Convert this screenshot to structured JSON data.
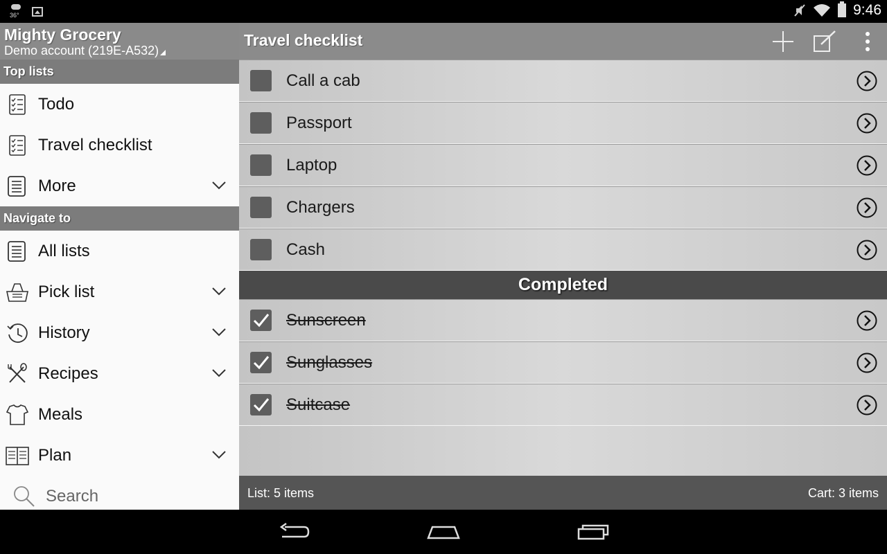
{
  "status_bar": {
    "weather_temp": "36°",
    "time": "9:46"
  },
  "drawer": {
    "app_title": "Mighty Grocery",
    "account": "Demo account (219E-A532)",
    "top_lists_header": "Top lists",
    "top_lists": [
      {
        "label": "Todo",
        "icon": "checklist-icon"
      },
      {
        "label": "Travel checklist",
        "icon": "checklist-icon"
      },
      {
        "label": "More",
        "icon": "list-icon"
      }
    ],
    "navigate_header": "Navigate to",
    "navigate": [
      {
        "label": "All lists",
        "icon": "list-icon"
      },
      {
        "label": "Pick list",
        "icon": "basket-icon"
      },
      {
        "label": "History",
        "icon": "history-icon"
      },
      {
        "label": "Recipes",
        "icon": "utensils-icon"
      },
      {
        "label": "Meals",
        "icon": "chef-hat-icon"
      },
      {
        "label": "Plan",
        "icon": "book-icon"
      }
    ],
    "search_label": "Search"
  },
  "main": {
    "title": "Travel checklist",
    "items": [
      {
        "label": "Call a cab",
        "checked": false
      },
      {
        "label": "Passport",
        "checked": false
      },
      {
        "label": "Laptop",
        "checked": false
      },
      {
        "label": "Chargers",
        "checked": false
      },
      {
        "label": "Cash",
        "checked": false
      }
    ],
    "completed_header": "Completed",
    "completed": [
      {
        "label": "Sunscreen",
        "checked": true
      },
      {
        "label": "Sunglasses",
        "checked": true
      },
      {
        "label": "Suitcase",
        "checked": true
      }
    ],
    "footer_left": "List: 5 items",
    "footer_right": "Cart: 3 items"
  },
  "colors": {
    "header_gray": "#8b8b8b",
    "completed_bar": "#4a4a4a",
    "footer_bar": "#555555"
  }
}
